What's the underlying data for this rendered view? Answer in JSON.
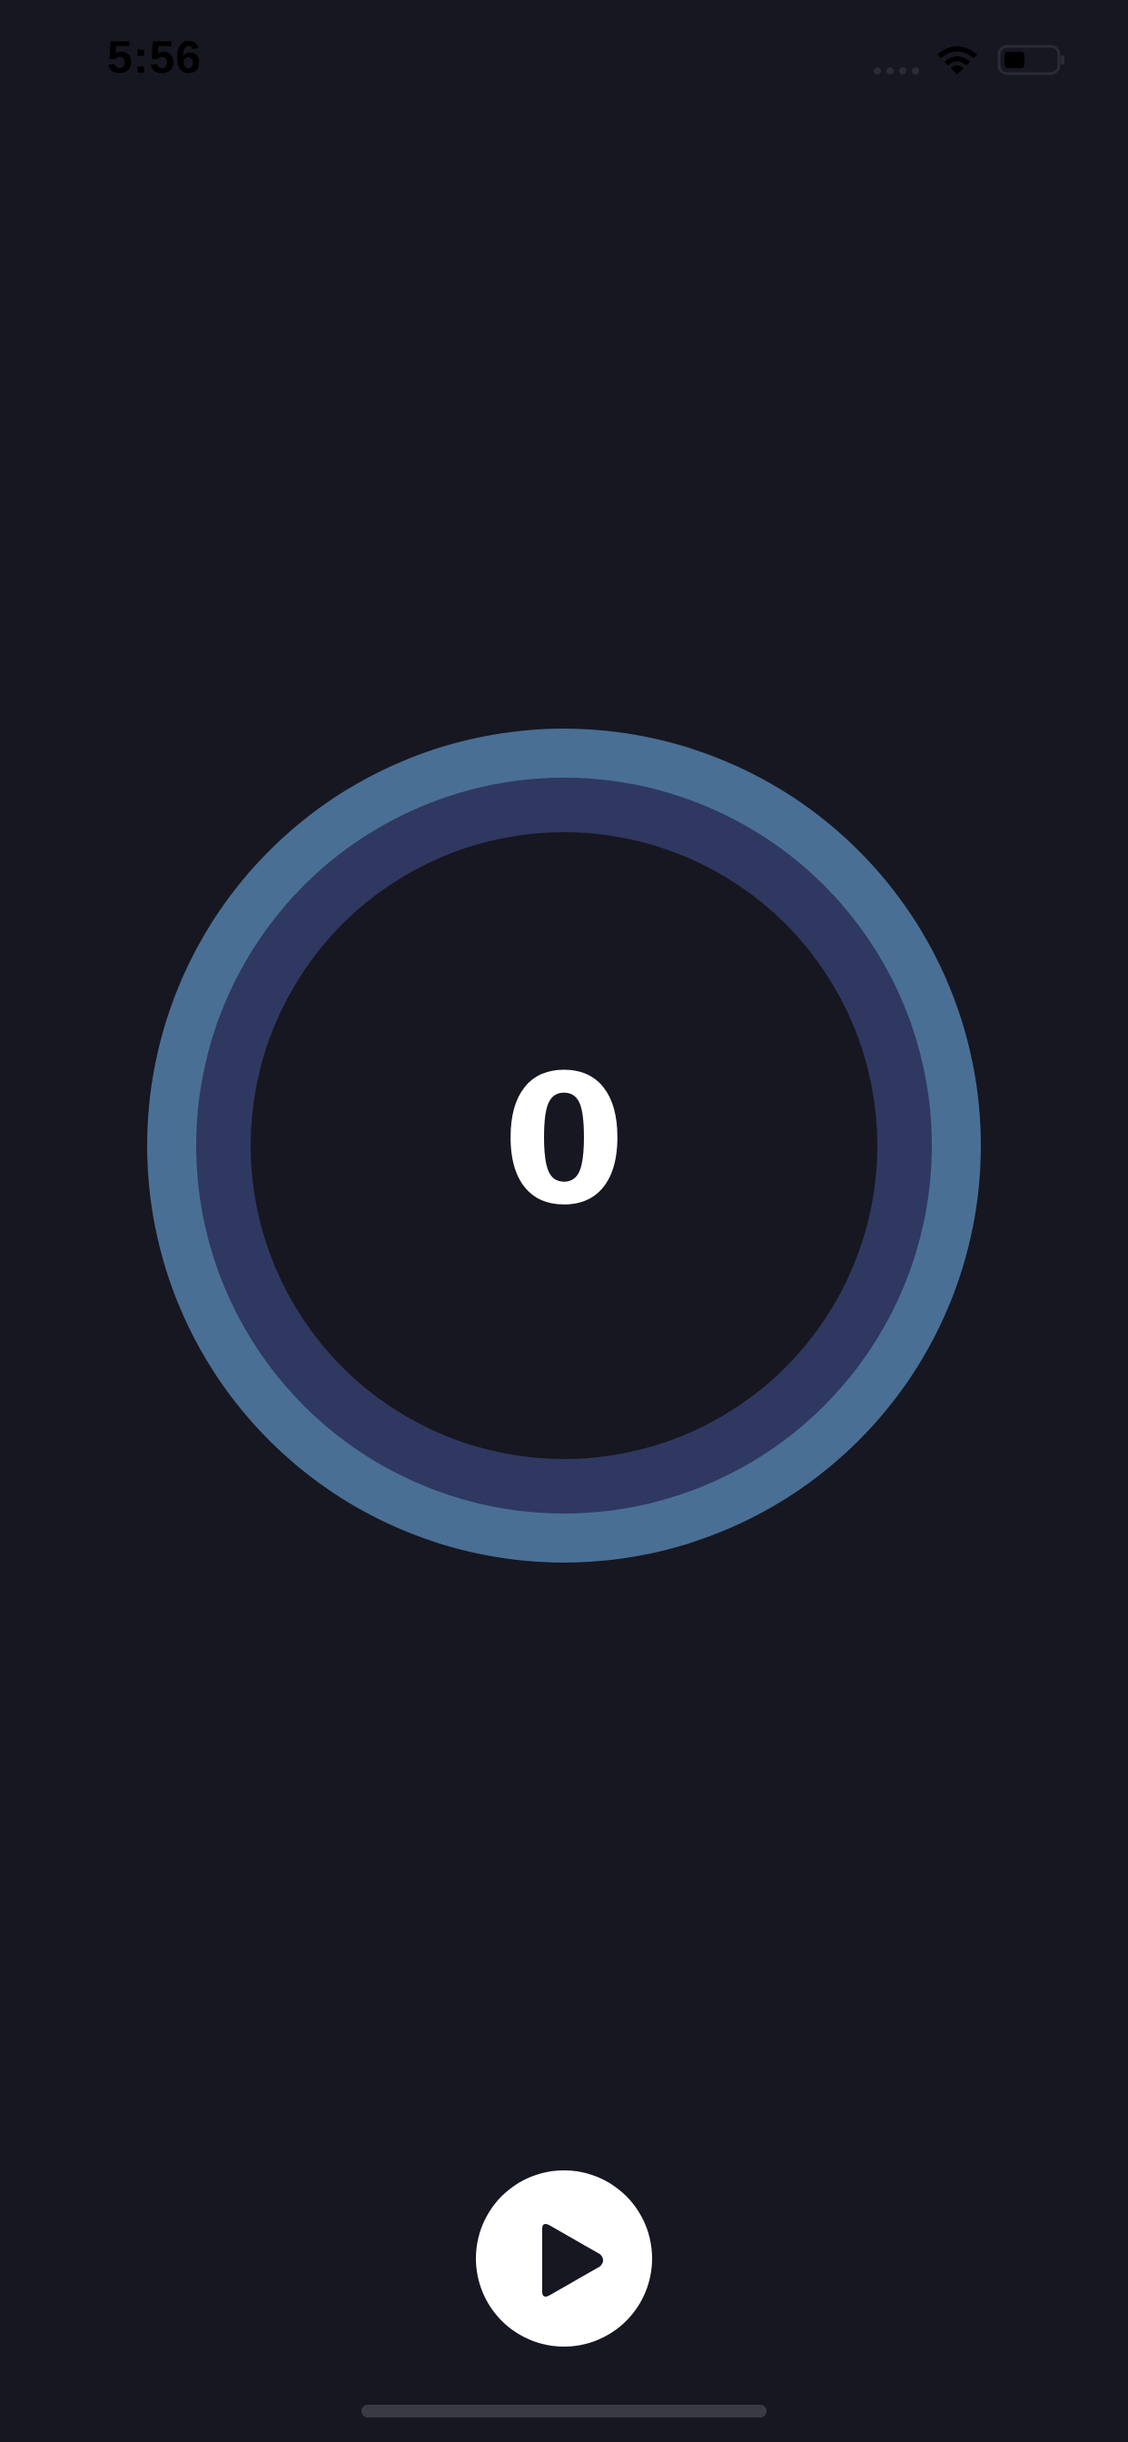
{
  "status_bar": {
    "time": "5:56"
  },
  "counter": {
    "value": "0"
  },
  "controls": {
    "play_icon": "play-icon"
  },
  "colors": {
    "background": "#171721",
    "ring_outer": "#4a6f95",
    "ring_middle": "#2f3860",
    "button": "#ffffff"
  }
}
